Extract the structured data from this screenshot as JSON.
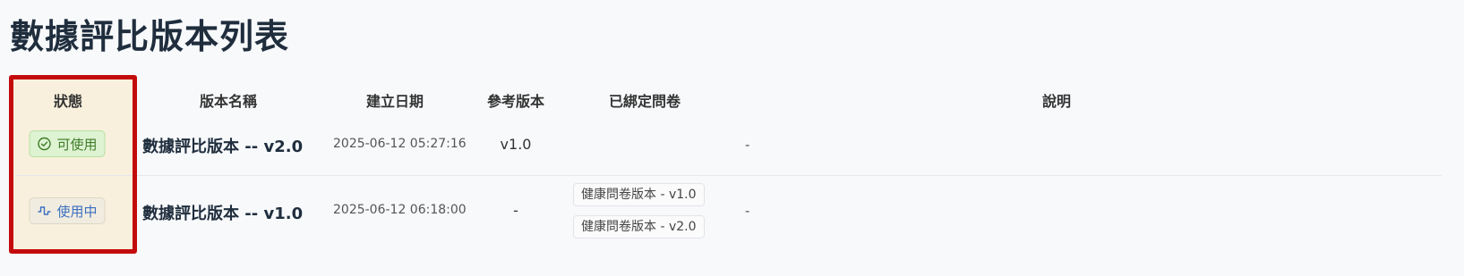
{
  "page": {
    "title": "數據評比版本列表"
  },
  "table": {
    "headers": {
      "status": "狀態",
      "version_name": "版本名稱",
      "created_date": "建立日期",
      "ref_version": "參考版本",
      "bound_questionnaires": "已綁定問卷",
      "description": "說明"
    },
    "rows": [
      {
        "status": "可使用",
        "status_icon": "check-circle-icon",
        "version_name": "數據評比版本 -- v2.0",
        "created_date": "2025-06-12 05:27:16",
        "ref_version": "v1.0",
        "bound_questionnaires": [],
        "description": "-"
      },
      {
        "status": "使用中",
        "status_icon": "pulse-icon",
        "version_name": "數據評比版本 -- v1.0",
        "created_date": "2025-06-12 06:18:00",
        "ref_version": "-",
        "bound_questionnaires": [
          "健康問卷版本 - v1.0",
          "健康問卷版本 - v2.0"
        ],
        "description": "-"
      }
    ]
  },
  "colors": {
    "highlight_border": "#c40b0b",
    "status_col_bg": "#f8f0dc",
    "available_green": "#3e7b27",
    "inuse_blue": "#3a6fc0"
  }
}
